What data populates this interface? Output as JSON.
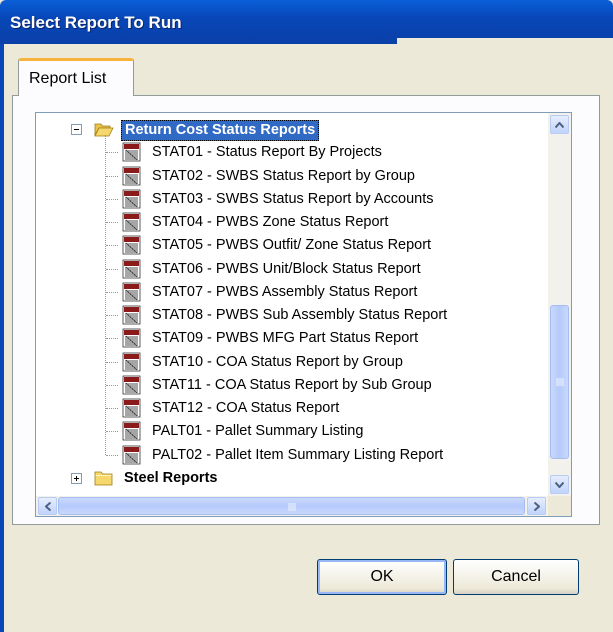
{
  "window": {
    "title": "Select Report To Run"
  },
  "tabs": [
    {
      "label": "Report List",
      "active": true
    }
  ],
  "tree": {
    "groups": [
      {
        "label": "Return Cost Status Reports",
        "expanded": true,
        "selected": true,
        "items": [
          "STAT01 - Status Report By Projects",
          "STAT02 - SWBS Status Report by Group",
          "STAT03 - SWBS Status Report by Accounts",
          "STAT04 - PWBS Zone Status Report",
          "STAT05 - PWBS Outfit/ Zone Status Report",
          "STAT06 - PWBS Unit/Block Status Report",
          "STAT07 - PWBS Assembly Status Report",
          "STAT08 - PWBS Sub Assembly Status Report",
          "STAT09 - PWBS MFG Part Status Report",
          "STAT10 - COA Status Report by Group",
          "STAT11 - COA Status Report by Sub Group",
          "STAT12 - COA Status Report",
          "PALT01 - Pallet Summary Listing",
          "PALT02 - Pallet Item Summary Listing Report"
        ]
      },
      {
        "label": "Steel Reports",
        "expanded": false,
        "selected": false,
        "items": []
      }
    ],
    "report_icon_text": "ENJ",
    "vertical_scroll_position": 0.55
  },
  "buttons": {
    "ok": "OK",
    "cancel": "Cancel"
  },
  "colors": {
    "titlebar": "#0847b8",
    "selection": "#316ac5",
    "tab_highlight": "#f7b33d",
    "dialog_bg": "#ece9d8",
    "folder": "#f5d76e",
    "report_icon": "#8b1a1a"
  }
}
